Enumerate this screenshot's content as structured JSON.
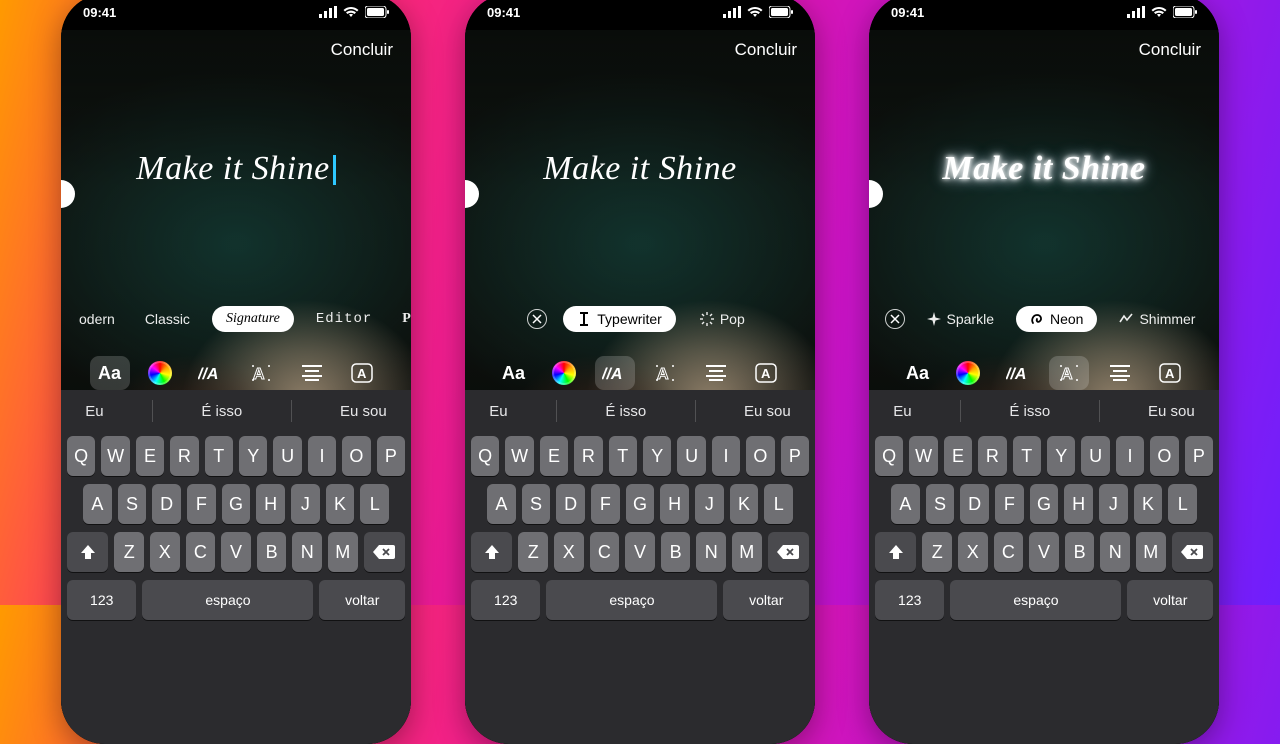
{
  "status": {
    "time": "09:41"
  },
  "top": {
    "done_label": "Concluir"
  },
  "overlay": {
    "text": "Make it Shine"
  },
  "fonts_row": {
    "items": [
      "odern",
      "Classic",
      "Signature",
      "Editor",
      "Pos"
    ],
    "selected": "Signature"
  },
  "anim_row": {
    "items": [
      "Typewriter",
      "Pop"
    ],
    "selected": "Typewriter"
  },
  "effects_row": {
    "items": [
      "Sparkle",
      "Neon",
      "Shimmer"
    ],
    "selected": "Neon"
  },
  "tools": {
    "size_label": "Aa",
    "slant_label": "//A",
    "outline_label": "A",
    "align_label": "≡",
    "bg_label": "A"
  },
  "suggestions": {
    "a": "Eu",
    "b": "É isso",
    "c": "Eu sou"
  },
  "keyboard": {
    "row1": [
      "Q",
      "W",
      "E",
      "R",
      "T",
      "Y",
      "U",
      "I",
      "O",
      "P"
    ],
    "row2": [
      "A",
      "S",
      "D",
      "F",
      "G",
      "H",
      "J",
      "K",
      "L"
    ],
    "row3": [
      "Z",
      "X",
      "C",
      "V",
      "B",
      "N",
      "M"
    ],
    "numbers": "123",
    "space": "espaço",
    "return": "voltar"
  }
}
